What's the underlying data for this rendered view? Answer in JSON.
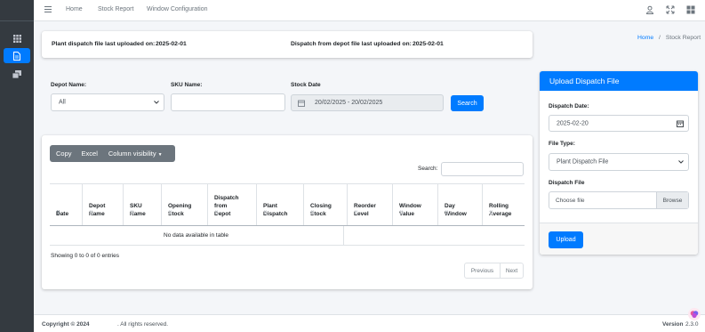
{
  "navbar": {
    "links": [
      "Home",
      "Stock Report",
      "Window Configuration"
    ]
  },
  "breadcrumb": {
    "home": "Home",
    "separator": "/",
    "current": "Stock Report"
  },
  "upload_info": {
    "plant_label": "Plant dispatch file last uploaded on:",
    "plant_date": "2025-02-01",
    "depot_label": "Dispatch from depot file last uploaded on:",
    "depot_date": "2025-02-01"
  },
  "filters": {
    "depot_label": "Depot Name:",
    "depot_value": "All",
    "sku_label": "SKU Name:",
    "sku_value": "",
    "stock_date_label": "Stock Date",
    "stock_date_value": "20/02/2025 - 20/02/2025",
    "search_button": "Search"
  },
  "table": {
    "buttons": [
      "Copy",
      "Excel",
      "Column visibility"
    ],
    "search_label": "Search:",
    "columns": [
      [
        "Date"
      ],
      [
        "Depot",
        "Name"
      ],
      [
        "SKU",
        "Name"
      ],
      [
        "Opening",
        "Stock"
      ],
      [
        "Dispatch",
        "from",
        "Depot"
      ],
      [
        "Plant",
        "Dispatch"
      ],
      [
        "Closing",
        "Stock"
      ],
      [
        "Reorder",
        "Level"
      ],
      [
        "Window",
        "Value"
      ],
      [
        "Day",
        "Window"
      ],
      [
        "Rolling",
        "Average"
      ]
    ],
    "empty_message": "No data available in table",
    "info": "Showing 0 to 0 of 0 entries",
    "previous": "Previous",
    "next": "Next"
  },
  "upload_panel": {
    "title": "Upload Dispatch File",
    "dispatch_date_label": "Dispatch Date:",
    "dispatch_date_value": "2025-02-20",
    "file_type_label": "File Type:",
    "file_type_value": "Plant Dispatch File",
    "dispatch_file_label": "Dispatch File",
    "file_placeholder": "Choose file",
    "browse_label": "Browse",
    "upload_button": "Upload"
  },
  "footer": {
    "copyright_bold": "Copyright © 2024",
    "copyright_rest": ". All rights reserved.",
    "version_bold": "Version",
    "version_value": "2.3.0"
  },
  "colors": {
    "primary": "#007bff",
    "sidebar": "#343a40",
    "secondary": "#6c757d"
  }
}
